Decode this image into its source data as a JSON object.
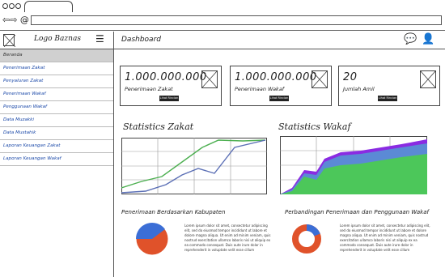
{
  "header": {
    "logo": "Logo Baznas",
    "page_title": "Dashboard"
  },
  "sidebar": {
    "items": [
      {
        "label": "Beranda"
      },
      {
        "label": "Penerimaan Zakat"
      },
      {
        "label": "Penyaluran Zakat"
      },
      {
        "label": "Penerimaan Wakaf"
      },
      {
        "label": "Penggunaan Wakaf"
      },
      {
        "label": "Data Muzakki"
      },
      {
        "label": "Data Mustahik"
      },
      {
        "label": "Laporan Keuangan Zakat"
      },
      {
        "label": "Laporan Keuangan Wakaf"
      }
    ]
  },
  "cards": [
    {
      "value": "1.000.000.000",
      "label": "Penerimaan Zakat",
      "button": "Lihat Rincian"
    },
    {
      "value": "1.000.000.000",
      "label": "Penerimaan Wakaf",
      "button": "Lihat Rincian"
    },
    {
      "value": "20",
      "label": "Jumlah Amil",
      "button": "Lihat Rincian"
    }
  ],
  "sections": {
    "stats_zakat": "Statistics Zakat",
    "stats_wakaf": "Statistics Wakaf",
    "penerimaan_kabupaten": "Penerimaan Berdasarkan Kabupaten",
    "perbandingan": "Perbandingan Penerimaan dan Penggunaan Wakaf"
  },
  "lorem": "Lorem ipsum dolor sit amet, consectetur adipiscing elit, sed do eiusmod tempor incididunt ut labore et dolore magna aliqua. Ut enim ad minim veniam, quis nostrud exercitation ullamco laboris nisi ut aliquip ex ea commodo consequat. Duis aute irure dolor in reprehenderit in voluptate velit esse cillum",
  "icons": [
    "menu-icon",
    "chat-icon",
    "user-icon",
    "image-placeholder-icon"
  ],
  "colors": {
    "link": "#1a48a8",
    "green": "#4caf50",
    "blue": "#5b7bd5",
    "purple": "#8a2be2",
    "orange": "#e0522a"
  }
}
